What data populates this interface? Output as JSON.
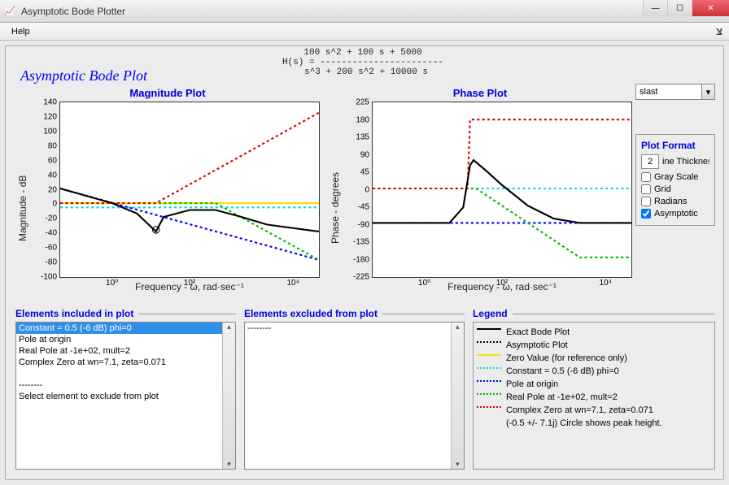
{
  "window": {
    "title": "Asymptotic Bode Plotter"
  },
  "menu": {
    "help": "Help",
    "anchor": "צּ"
  },
  "app_title": "Asymptotic Bode Plot",
  "equation": {
    "num": "100 s^2 + 100 s + 5000",
    "label": "H(s) = -----------------------",
    "den": "s^3 + 200 s^2 + 10000 s"
  },
  "mag_plot": {
    "title": "Magnitude Plot",
    "ylabel": "Magnitude - dB",
    "xlabel": "Frequency - ω, rad·sec⁻¹",
    "yticks": [
      "140",
      "120",
      "100",
      "80",
      "60",
      "40",
      "20",
      "0",
      "-20",
      "-40",
      "-60",
      "-80",
      "-100"
    ],
    "xticks": [
      "10⁰",
      "10²",
      "10⁴"
    ]
  },
  "phase_plot": {
    "title": "Phase Plot",
    "ylabel": "Phase - degrees",
    "xlabel": "Frequency - ω, rad·sec⁻¹",
    "yticks": [
      "225",
      "180",
      "135",
      "90",
      "45",
      "0",
      "-45",
      "-90",
      "-135",
      "-180",
      "-225"
    ],
    "xticks": [
      "10⁰",
      "10²",
      "10⁴"
    ]
  },
  "combo": {
    "value": "slast"
  },
  "format_panel": {
    "title": "Plot Format",
    "thickness_value": "2",
    "thickness_label": "ine Thickness",
    "gray": "Gray Scale",
    "grid": "Grid",
    "radians": "Radians",
    "asymptotic": "Asymptotic"
  },
  "included": {
    "title": "Elements included in plot",
    "items": [
      "Constant = 0.5 (-6 dB) phi=0",
      "Pole at origin",
      "Real Pole at -1e+02, mult=2",
      "Complex Zero at wn=7.1, zeta=0.071",
      "",
      "--------",
      "Select element to exclude from plot"
    ],
    "selected_index": 0
  },
  "excluded": {
    "title": "Elements excluded from plot",
    "items": [
      "--------"
    ]
  },
  "legend": {
    "title": "Legend",
    "exact": "Exact Bode Plot",
    "asym": "Asymptotic Plot",
    "zeroval": "Zero Value (for reference only)",
    "const": "Constant = 0.5 (-6 dB) phi=0",
    "pole": "Pole at origin",
    "realp": "Real Pole at -1e+02, mult=2",
    "czero1": "Complex Zero at wn=7.1, zeta=0.071",
    "czero2": "(-0.5 +/- 7.1j)  Circle shows peak height."
  },
  "chart_data": [
    {
      "type": "line",
      "title": "Magnitude Plot",
      "xlabel": "Frequency (rad/s)",
      "ylabel": "Magnitude (dB)",
      "x_scale": "log",
      "xlim": [
        0.1,
        10000
      ],
      "ylim": [
        -100,
        140
      ],
      "series": [
        {
          "name": "Exact Bode Plot",
          "color": "#000",
          "x": [
            0.1,
            1,
            3,
            7.1,
            10,
            30,
            100,
            300,
            1000,
            10000
          ],
          "values": [
            20,
            0,
            -15,
            -40,
            -20,
            -10,
            -10,
            -20,
            -30,
            -40
          ]
        },
        {
          "name": "Constant",
          "color": "#0dd",
          "x": [
            0.1,
            10000
          ],
          "values": [
            -6,
            -6
          ]
        },
        {
          "name": "Pole at origin",
          "color": "#00f",
          "x": [
            0.1,
            10000
          ],
          "values": [
            20,
            -80
          ]
        },
        {
          "name": "Real Pole mult=2",
          "color": "#0b0",
          "x": [
            0.1,
            100,
            10000
          ],
          "values": [
            0,
            0,
            -80
          ]
        },
        {
          "name": "Complex Zero",
          "color": "#d00",
          "x": [
            0.1,
            7.1,
            10000
          ],
          "values": [
            0,
            0,
            126
          ]
        },
        {
          "name": "Zero ref",
          "color": "#fd0",
          "x": [
            0.1,
            10000
          ],
          "values": [
            0,
            0
          ]
        }
      ]
    },
    {
      "type": "line",
      "title": "Phase Plot",
      "xlabel": "Frequency (rad/s)",
      "ylabel": "Phase (degrees)",
      "x_scale": "log",
      "xlim": [
        0.1,
        10000
      ],
      "ylim": [
        -225,
        225
      ],
      "series": [
        {
          "name": "Exact Bode Plot",
          "color": "#000",
          "x": [
            0.1,
            3,
            6,
            8,
            12,
            30,
            100,
            300,
            1000,
            10000
          ],
          "values": [
            -90,
            -90,
            -50,
            60,
            50,
            10,
            -45,
            -80,
            -90,
            -90
          ]
        },
        {
          "name": "Constant",
          "color": "#0dd",
          "x": [
            0.1,
            10000
          ],
          "values": [
            0,
            0
          ]
        },
        {
          "name": "Pole at origin",
          "color": "#00f",
          "x": [
            0.1,
            10000
          ],
          "values": [
            -90,
            -90
          ]
        },
        {
          "name": "Real Pole mult=2",
          "color": "#0b0",
          "x": [
            0.1,
            10,
            1000,
            10000
          ],
          "values": [
            0,
            0,
            -180,
            -180
          ]
        },
        {
          "name": "Complex Zero",
          "color": "#d00",
          "x": [
            0.1,
            7,
            7.2,
            10000
          ],
          "values": [
            0,
            0,
            180,
            180
          ]
        }
      ]
    }
  ]
}
